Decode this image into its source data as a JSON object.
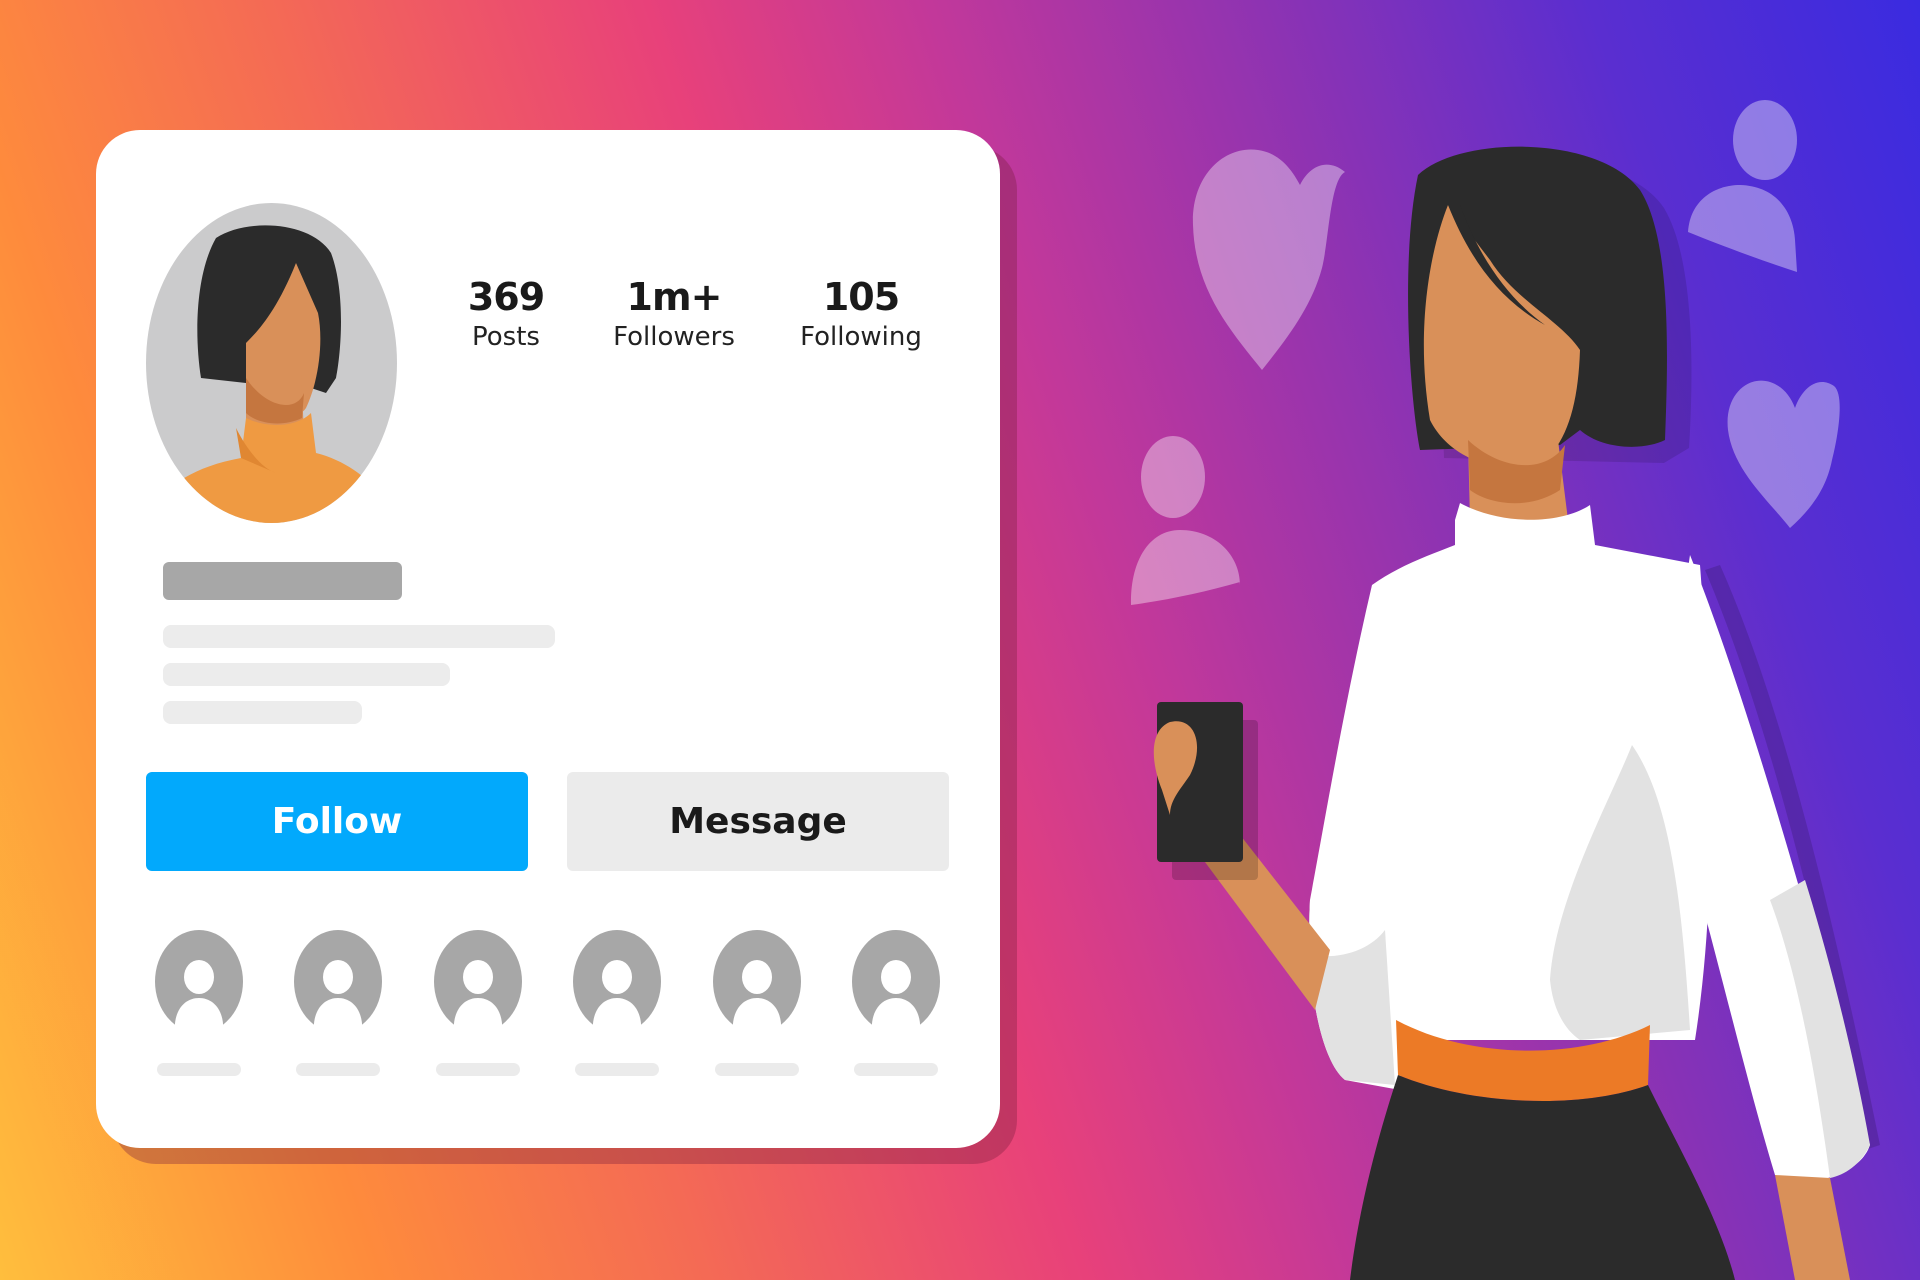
{
  "profile": {
    "stats": [
      {
        "value": "369",
        "label": "Posts"
      },
      {
        "value": "1m+",
        "label": "Followers"
      },
      {
        "value": "105",
        "label": "Following"
      }
    ],
    "actions": {
      "follow_label": "Follow",
      "message_label": "Message"
    },
    "suggested_accounts_count": 6
  },
  "colors": {
    "follow_button": "#02a9fc",
    "message_button": "#ebebeb",
    "hair": "#2b2b2b",
    "skin": "#d99059",
    "sweater": "#ef9a42",
    "belt": "#ec7a26",
    "placeholder_gray": "#a7a7a7"
  },
  "decorations": [
    "heart-icon",
    "user-icon",
    "user-icon",
    "heart-icon"
  ]
}
